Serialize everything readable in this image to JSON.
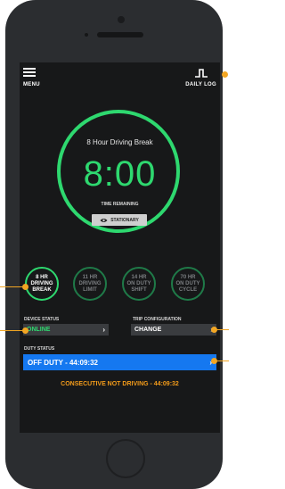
{
  "header": {
    "menu_label": "MENU",
    "daily_log_label": "DAILY LOG"
  },
  "timer": {
    "title": "8 Hour Driving Break",
    "time": "8:00",
    "subtitle": "TIME REMAINING",
    "stationary_label": "STATIONARY"
  },
  "limits": [
    {
      "lines": [
        "8 HR",
        "DRIVING",
        "BREAK"
      ],
      "active": true
    },
    {
      "lines": [
        "11 HR",
        "DRIVING",
        "LIMIT"
      ],
      "active": false
    },
    {
      "lines": [
        "14 HR",
        "ON DUTY",
        "SHIFT"
      ],
      "active": false
    },
    {
      "lines": [
        "70 HR",
        "ON DUTY",
        "CYCLE"
      ],
      "active": false
    }
  ],
  "device_status": {
    "label": "DEVICE STATUS",
    "value": "ONLINE"
  },
  "trip_configuration": {
    "label": "TRIP CONFIGURATION",
    "value": "CHANGE"
  },
  "duty_status": {
    "label": "DUTY STATUS",
    "value": "OFF DUTY - 44:09:32"
  },
  "consecutive_text": "CONSECUTIVE NOT DRIVING - 44:09:32",
  "colors": {
    "accent_green": "#2ed86f",
    "duty_blue": "#1578f0",
    "warning_orange": "#f29b1a",
    "callout": "#f2a623"
  }
}
